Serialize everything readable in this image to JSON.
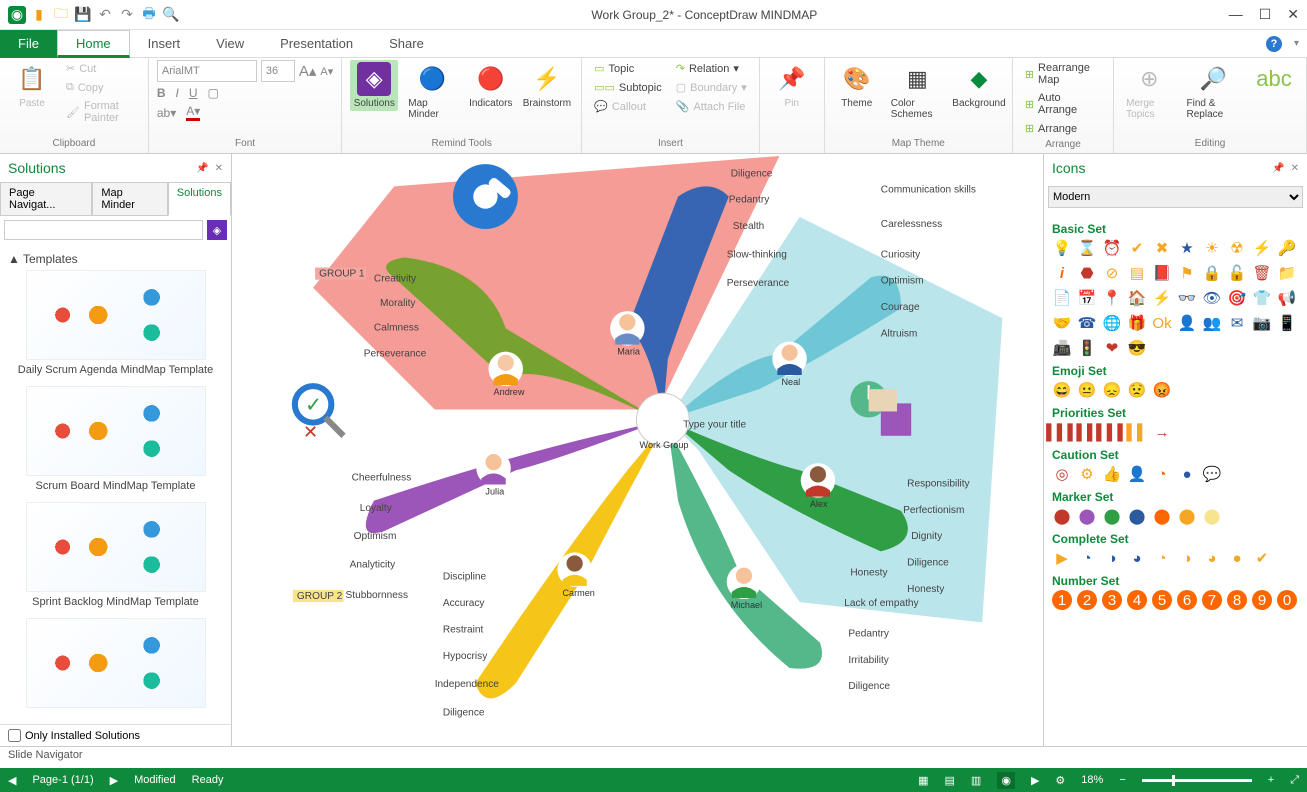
{
  "titlebar": {
    "title": "Work Group_2* - ConceptDraw MINDMAP"
  },
  "menu": {
    "file": "File",
    "tabs": [
      "Home",
      "Insert",
      "View",
      "Presentation",
      "Share"
    ],
    "active": 0
  },
  "ribbon": {
    "clipboard": {
      "label": "Clipboard",
      "paste": "Paste",
      "cut": "Cut",
      "copy": "Copy",
      "format_painter": "Format Painter"
    },
    "font": {
      "label": "Font",
      "name": "ArialMT",
      "size": "36"
    },
    "remind": {
      "label": "Remind Tools",
      "solutions": "Solutions",
      "map_minder": "Map Minder",
      "indicators": "Indicators",
      "brainstorm": "Brainstorm"
    },
    "insert": {
      "label": "Insert",
      "topic": "Topic",
      "subtopic": "Subtopic",
      "callout": "Callout",
      "relation": "Relation",
      "boundary": "Boundary",
      "attach": "Attach  File"
    },
    "pin": {
      "label": "",
      "pin": "Pin"
    },
    "maptheme": {
      "label": "Map Theme",
      "theme": "Theme",
      "color": "Color Schemes",
      "bg": "Background"
    },
    "arrange": {
      "label": "Arrange",
      "rearrange": "Rearrange Map",
      "auto": "Auto Arrange",
      "arrange": "Arrange"
    },
    "editing": {
      "label": "Editing",
      "merge": "Merge Topics",
      "find": "Find & Replace"
    }
  },
  "left": {
    "title": "Solutions",
    "tabs": [
      "Page Navigat...",
      "Map Minder",
      "Solutions"
    ],
    "templates_h": "▲ Templates",
    "templates": [
      "Daily Scrum Agenda MindMap Template",
      "Scrum Board MindMap Template",
      "Sprint Backlog MindMap Template"
    ],
    "only_installed": "Only Installed Solutions"
  },
  "mindmap": {
    "center": "Work Group",
    "center_hint": "Type your title",
    "group1": "GROUP 1",
    "group2": "GROUP 2",
    "people": {
      "andrew": {
        "name": "Andrew",
        "traits": [
          "Creativity",
          "Morality",
          "Calmness",
          "Perseverance"
        ]
      },
      "maria": {
        "name": "Maria",
        "traits": [
          "Diligence",
          "Pedantry",
          "Stealth",
          "Slow-thinking",
          "Perseverance"
        ]
      },
      "neal": {
        "name": "Neal",
        "traits": [
          "Communication skills",
          "Carelessness",
          "Curiosity",
          "Optimism",
          "Courage",
          "Altruism"
        ]
      },
      "julia": {
        "name": "Julia",
        "traits": [
          "Cheerfulness",
          "Loyalty",
          "Optimism",
          "Analyticity",
          "Stubbornness"
        ]
      },
      "carmen": {
        "name": "Carmen",
        "traits": [
          "Discipline",
          "Accuracy",
          "Restraint",
          "Hypocrisy",
          "Independence",
          "Diligence"
        ]
      },
      "michael": {
        "name": "Michael",
        "traits": [
          "Honesty",
          "Lack of empathy",
          "Pedantry",
          "Irritability",
          "Diligence"
        ]
      },
      "alex": {
        "name": "Alex",
        "traits": [
          "Responsibility",
          "Perfectionism",
          "Dignity",
          "Diligence",
          "Honesty"
        ]
      }
    }
  },
  "right": {
    "title": "Icons",
    "style": "Modern",
    "sets": {
      "basic": "Basic Set",
      "emoji": "Emoji Set",
      "priorities": "Priorities Set",
      "caution": "Caution Set",
      "marker": "Marker Set",
      "complete": "Complete Set",
      "number": "Number Set"
    }
  },
  "slidenav": "Slide Navigator",
  "status": {
    "page": "Page-1 (1/1)",
    "modified": "Modified",
    "ready": "Ready",
    "zoom": "18%"
  }
}
